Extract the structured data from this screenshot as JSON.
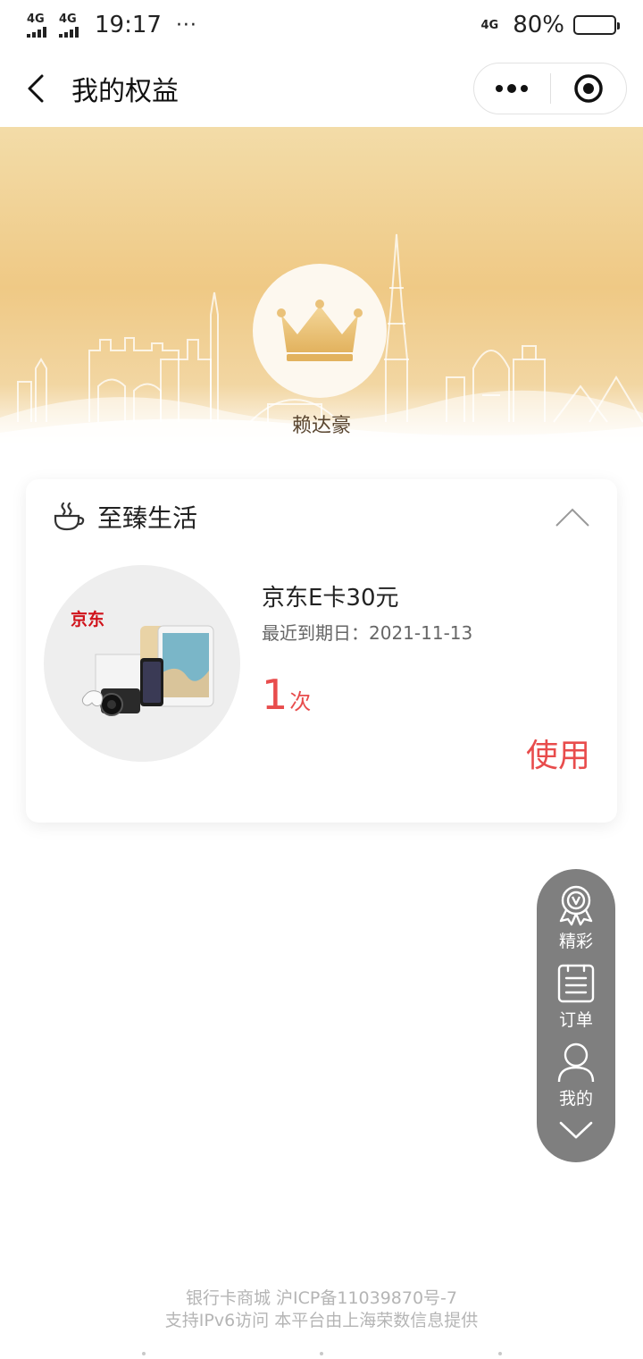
{
  "status_bar": {
    "network1": "4G",
    "network2": "4G",
    "time": "19:17",
    "more": "···",
    "network3": "4G",
    "battery": "80%",
    "battery_level": 0.8
  },
  "nav": {
    "title": "我的权益"
  },
  "profile": {
    "name": "赖达豪"
  },
  "section": {
    "title": "至臻生活"
  },
  "benefit": {
    "brand": "京东",
    "name": "京东E卡30元",
    "expire": "最近到期日：2021-11-13",
    "count": "1",
    "count_unit": "次",
    "use_label": "使用"
  },
  "float_menu": {
    "items": [
      {
        "label": "精彩",
        "icon": "badge-icon"
      },
      {
        "label": "订单",
        "icon": "order-list-icon"
      },
      {
        "label": "我的",
        "icon": "user-icon"
      }
    ]
  },
  "footer": {
    "line1": "银行卡商城 沪ICP备11039870号-7",
    "line2": "支持IPv6访问 本平台由上海荣数信息提供"
  },
  "colors": {
    "accent": "#e84c4c",
    "banner_gold": "#efc985",
    "float_menu_bg": "#7f7f7f"
  }
}
